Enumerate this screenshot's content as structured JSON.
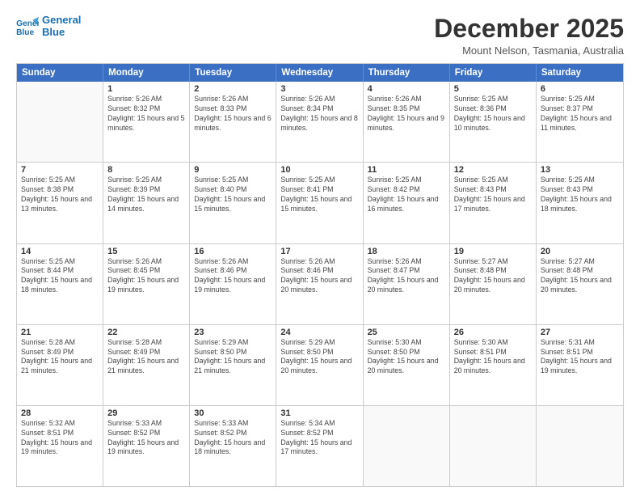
{
  "logo": {
    "line1": "General",
    "line2": "Blue"
  },
  "title": "December 2025",
  "subtitle": "Mount Nelson, Tasmania, Australia",
  "days_of_week": [
    "Sunday",
    "Monday",
    "Tuesday",
    "Wednesday",
    "Thursday",
    "Friday",
    "Saturday"
  ],
  "weeks": [
    [
      {
        "day": "",
        "empty": true
      },
      {
        "day": "1",
        "sunrise": "5:26 AM",
        "sunset": "8:32 PM",
        "daylight": "15 hours and 5 minutes."
      },
      {
        "day": "2",
        "sunrise": "5:26 AM",
        "sunset": "8:33 PM",
        "daylight": "15 hours and 6 minutes."
      },
      {
        "day": "3",
        "sunrise": "5:26 AM",
        "sunset": "8:34 PM",
        "daylight": "15 hours and 8 minutes."
      },
      {
        "day": "4",
        "sunrise": "5:26 AM",
        "sunset": "8:35 PM",
        "daylight": "15 hours and 9 minutes."
      },
      {
        "day": "5",
        "sunrise": "5:25 AM",
        "sunset": "8:36 PM",
        "daylight": "15 hours and 10 minutes."
      },
      {
        "day": "6",
        "sunrise": "5:25 AM",
        "sunset": "8:37 PM",
        "daylight": "15 hours and 11 minutes."
      }
    ],
    [
      {
        "day": "7",
        "sunrise": "5:25 AM",
        "sunset": "8:38 PM",
        "daylight": "15 hours and 13 minutes."
      },
      {
        "day": "8",
        "sunrise": "5:25 AM",
        "sunset": "8:39 PM",
        "daylight": "15 hours and 14 minutes."
      },
      {
        "day": "9",
        "sunrise": "5:25 AM",
        "sunset": "8:40 PM",
        "daylight": "15 hours and 15 minutes."
      },
      {
        "day": "10",
        "sunrise": "5:25 AM",
        "sunset": "8:41 PM",
        "daylight": "15 hours and 15 minutes."
      },
      {
        "day": "11",
        "sunrise": "5:25 AM",
        "sunset": "8:42 PM",
        "daylight": "15 hours and 16 minutes."
      },
      {
        "day": "12",
        "sunrise": "5:25 AM",
        "sunset": "8:43 PM",
        "daylight": "15 hours and 17 minutes."
      },
      {
        "day": "13",
        "sunrise": "5:25 AM",
        "sunset": "8:43 PM",
        "daylight": "15 hours and 18 minutes."
      }
    ],
    [
      {
        "day": "14",
        "sunrise": "5:25 AM",
        "sunset": "8:44 PM",
        "daylight": "15 hours and 18 minutes."
      },
      {
        "day": "15",
        "sunrise": "5:26 AM",
        "sunset": "8:45 PM",
        "daylight": "15 hours and 19 minutes."
      },
      {
        "day": "16",
        "sunrise": "5:26 AM",
        "sunset": "8:46 PM",
        "daylight": "15 hours and 19 minutes."
      },
      {
        "day": "17",
        "sunrise": "5:26 AM",
        "sunset": "8:46 PM",
        "daylight": "15 hours and 20 minutes."
      },
      {
        "day": "18",
        "sunrise": "5:26 AM",
        "sunset": "8:47 PM",
        "daylight": "15 hours and 20 minutes."
      },
      {
        "day": "19",
        "sunrise": "5:27 AM",
        "sunset": "8:48 PM",
        "daylight": "15 hours and 20 minutes."
      },
      {
        "day": "20",
        "sunrise": "5:27 AM",
        "sunset": "8:48 PM",
        "daylight": "15 hours and 20 minutes."
      }
    ],
    [
      {
        "day": "21",
        "sunrise": "5:28 AM",
        "sunset": "8:49 PM",
        "daylight": "15 hours and 21 minutes."
      },
      {
        "day": "22",
        "sunrise": "5:28 AM",
        "sunset": "8:49 PM",
        "daylight": "15 hours and 21 minutes."
      },
      {
        "day": "23",
        "sunrise": "5:29 AM",
        "sunset": "8:50 PM",
        "daylight": "15 hours and 21 minutes."
      },
      {
        "day": "24",
        "sunrise": "5:29 AM",
        "sunset": "8:50 PM",
        "daylight": "15 hours and 20 minutes."
      },
      {
        "day": "25",
        "sunrise": "5:30 AM",
        "sunset": "8:50 PM",
        "daylight": "15 hours and 20 minutes."
      },
      {
        "day": "26",
        "sunrise": "5:30 AM",
        "sunset": "8:51 PM",
        "daylight": "15 hours and 20 minutes."
      },
      {
        "day": "27",
        "sunrise": "5:31 AM",
        "sunset": "8:51 PM",
        "daylight": "15 hours and 19 minutes."
      }
    ],
    [
      {
        "day": "28",
        "sunrise": "5:32 AM",
        "sunset": "8:51 PM",
        "daylight": "15 hours and 19 minutes."
      },
      {
        "day": "29",
        "sunrise": "5:33 AM",
        "sunset": "8:52 PM",
        "daylight": "15 hours and 19 minutes."
      },
      {
        "day": "30",
        "sunrise": "5:33 AM",
        "sunset": "8:52 PM",
        "daylight": "15 hours and 18 minutes."
      },
      {
        "day": "31",
        "sunrise": "5:34 AM",
        "sunset": "8:52 PM",
        "daylight": "15 hours and 17 minutes."
      },
      {
        "day": "",
        "empty": true
      },
      {
        "day": "",
        "empty": true
      },
      {
        "day": "",
        "empty": true
      }
    ]
  ]
}
